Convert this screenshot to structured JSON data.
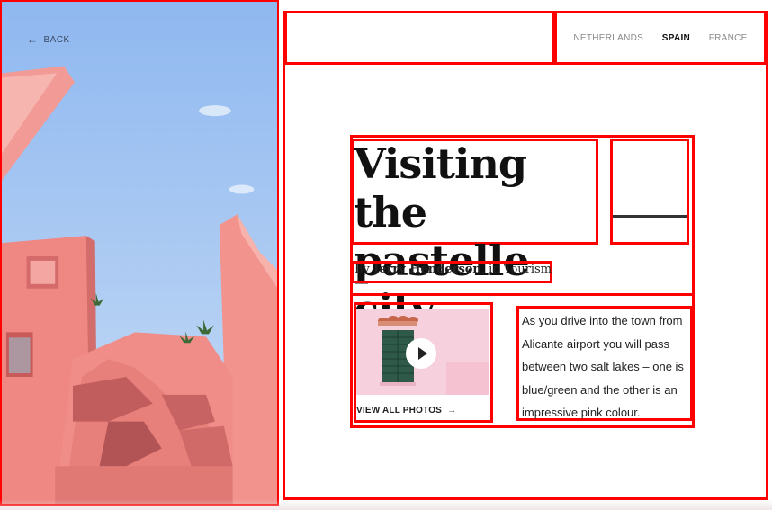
{
  "hero": {
    "back_label": "BACK",
    "back_icon": "arrow-left-icon",
    "sky_color": "#a9c9f1",
    "building_color": "#f08a8a"
  },
  "nav": {
    "items": [
      {
        "label": "NETHERLANDS",
        "active": false
      },
      {
        "label": "SPAIN",
        "active": true
      },
      {
        "label": "FRANCE",
        "active": false
      }
    ]
  },
  "article": {
    "title_line1": "Visiting the",
    "title_line2": "pastelle city",
    "byline_prefix": "By ",
    "author": "Jerry Henderson",
    "byline_suffix": ", in Tourism",
    "body": "As you drive into the town from Alicante airport you will pass between two salt lakes – one is blue/green and the other is an impressive pink colour.",
    "view_all_label": "VIEW ALL PHOTOS",
    "view_all_icon": "arrow-right-icon",
    "play_icon": "play-icon"
  },
  "colors": {
    "accent": "#ff0000",
    "wall_pink": "#f7d0dd",
    "shutter_green": "#2f5a4a"
  }
}
